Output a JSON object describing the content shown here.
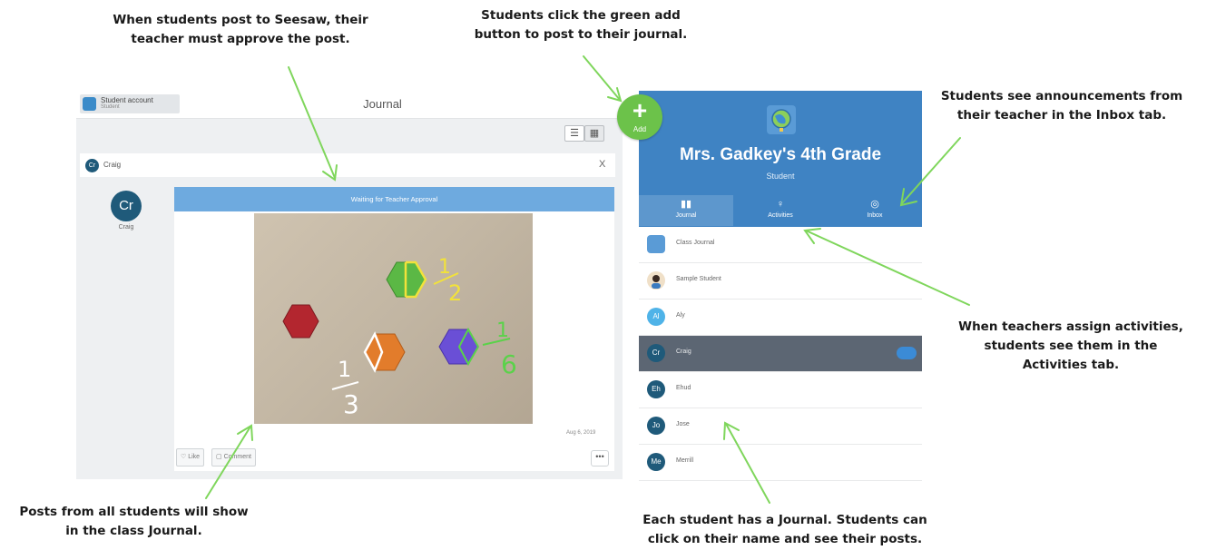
{
  "callouts": {
    "approve": [
      "When students post to Seesaw, their",
      "teacher must approve the post."
    ],
    "add": [
      "Students click the green add",
      "button to post to their journal."
    ],
    "inbox": [
      "Students see announcements from",
      "their teacher in the Inbox tab."
    ],
    "activities": [
      "When teachers assign activities,",
      "students see them in the",
      "Activities tab."
    ],
    "class_journal": [
      "Posts from all students will show",
      "in the class Journal."
    ],
    "student_journal": [
      "Each student has a Journal. Students can",
      "click on their name and see their posts."
    ]
  },
  "journal": {
    "title": "Journal",
    "account_name": "Student account",
    "account_role": "Student",
    "post": {
      "author_initials": "Cr",
      "author_name": "Craig",
      "close_glyph": "X",
      "status": "Waiting for Teacher Approval",
      "date": "Aug 6, 2019",
      "like_label": "Like",
      "comment_label": "Comment",
      "more_glyph": "•••"
    }
  },
  "add_button": {
    "plus": "+",
    "label": "Add",
    "color": "#6cc24a"
  },
  "class_panel": {
    "name": "Mrs. Gadkey's 4th Grade",
    "role": "Student",
    "header_color": "#3f83c3",
    "tabs": [
      {
        "label": "Journal",
        "icon": "book-icon",
        "glyph": "▮▮"
      },
      {
        "label": "Activities",
        "icon": "lightbulb-icon",
        "glyph": "♀"
      },
      {
        "label": "Inbox",
        "icon": "chat-icon",
        "glyph": "◎"
      }
    ],
    "students": [
      {
        "initials": "",
        "name": "Class Journal",
        "avatar": "globe-icon"
      },
      {
        "initials": "",
        "name": "Sample Student",
        "avatar": "person-icon"
      },
      {
        "initials": "Al",
        "name": "Aly",
        "color": "#4fb3e8"
      },
      {
        "initials": "Cr",
        "name": "Craig",
        "color": "#1f5a7a",
        "selected": true
      },
      {
        "initials": "Eh",
        "name": "Ehud",
        "color": "#1f5a7a"
      },
      {
        "initials": "Jo",
        "name": "Jose",
        "color": "#1f5a7a"
      },
      {
        "initials": "Me",
        "name": "Merrill",
        "color": "#1f5a7a"
      }
    ]
  },
  "photo_marks": {
    "half": [
      "1",
      "2"
    ],
    "sixth": [
      "1",
      "6"
    ],
    "third": [
      "1",
      "3"
    ]
  }
}
